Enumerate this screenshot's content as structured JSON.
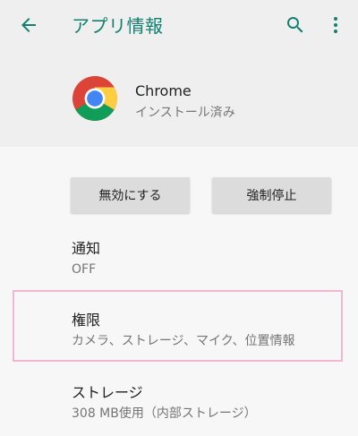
{
  "header": {
    "title": "アプリ情報",
    "back_icon": "arrow-back-icon",
    "search_icon": "search-icon",
    "more_icon": "more-vert-icon"
  },
  "app": {
    "name": "Chrome",
    "status": "インストール済み",
    "icon": "chrome-logo"
  },
  "buttons": {
    "disable": "無効にする",
    "force_stop": "強制停止"
  },
  "preferences": [
    {
      "title": "通知",
      "summary": "OFF"
    },
    {
      "title": "権限",
      "summary": "カメラ、ストレージ、マイク、位置情報",
      "highlighted": true
    },
    {
      "title": "ストレージ",
      "summary": "308 MB使用（内部ストレージ）"
    }
  ],
  "colors": {
    "accent": "#11806f",
    "highlight_border": "#f2b8d2"
  }
}
